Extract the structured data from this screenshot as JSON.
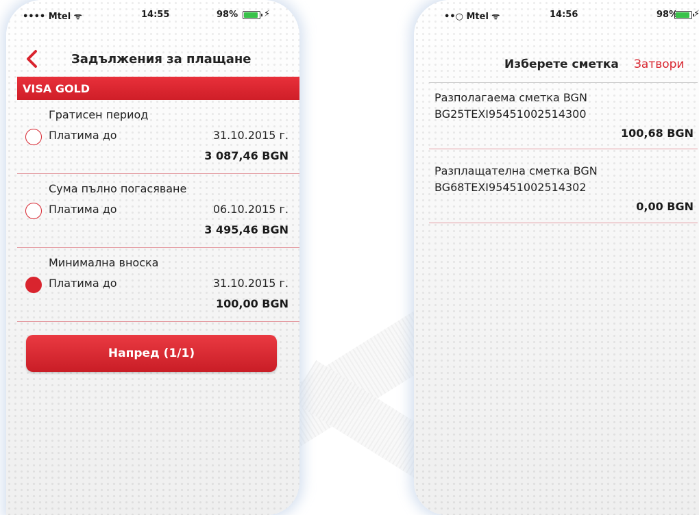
{
  "left_screen": {
    "status_bar": {
      "carrier": "•••• Mtel ᯤ",
      "time": "14:55",
      "battery": "98%"
    },
    "header": {
      "title": "Задължения за плащане"
    },
    "card_name": "VISA GOLD",
    "options": [
      {
        "name": "Гратисен период",
        "label": "Платима до",
        "date": "31.10.2015 г.",
        "amount": "3 087,46 BGN",
        "selected": false
      },
      {
        "name": "Сума пълно погасяване",
        "label": "Платима до",
        "date": "06.10.2015 г.",
        "amount": "3 495,46 BGN",
        "selected": false
      },
      {
        "name": "Минимална вноска",
        "label": "Платима до",
        "date": "31.10.2015 г.",
        "amount": "100,00 BGN",
        "selected": true
      }
    ],
    "next_button": "Напред (1/1)"
  },
  "right_screen": {
    "status_bar": {
      "carrier": "••○ Mtel ᯤ",
      "time": "14:56",
      "battery": "98%"
    },
    "title": "Изберете сметка",
    "close_label": "Затвори",
    "accounts": [
      {
        "name": "Разполагаема сметка BGN",
        "iban": "BG25TEXI95451002514300",
        "balance": "100,68 BGN"
      },
      {
        "name": "Разплащателна сметка BGN",
        "iban": "BG68TEXI95451002514302",
        "balance": "0,00 BGN"
      }
    ]
  },
  "colors": {
    "accent": "#d9242e",
    "divider": "#e39aa0"
  }
}
